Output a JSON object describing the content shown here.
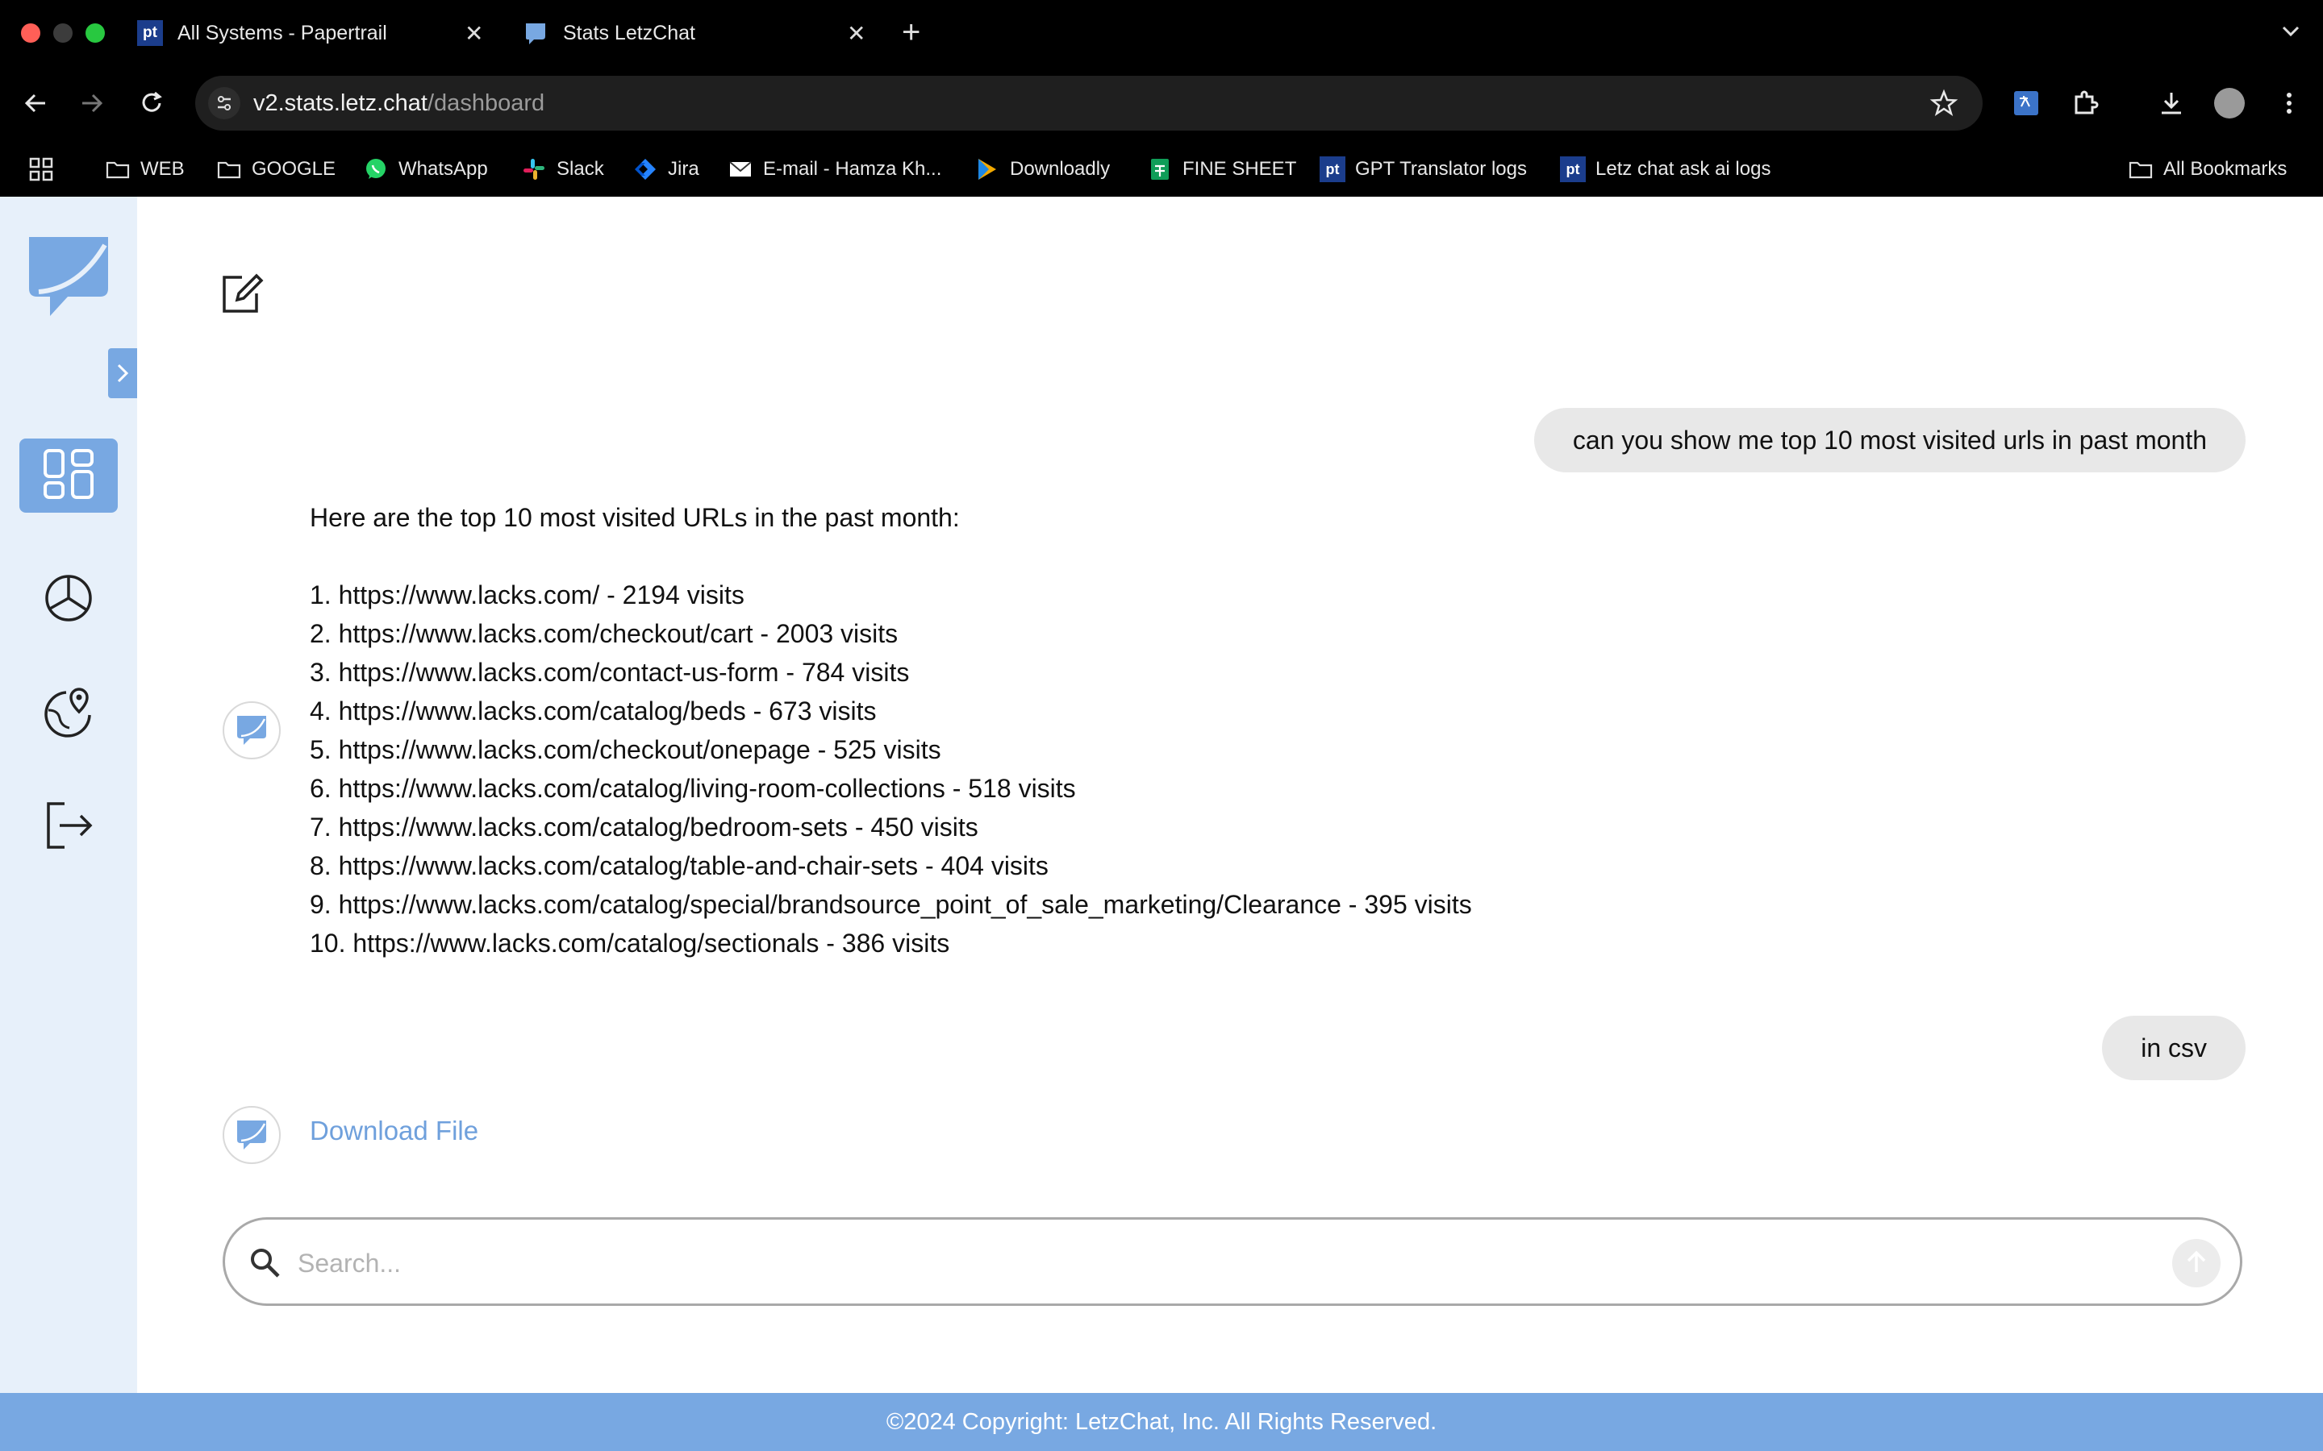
{
  "browser": {
    "tabs": [
      {
        "favicon_text": "pt",
        "title": "All Systems - Papertrail"
      },
      {
        "favicon_text": "",
        "title": "Stats LetzChat"
      }
    ],
    "url_host": "v2.stats.letz.chat",
    "url_path": "/dashboard",
    "bookmarks": [
      {
        "icon": "folder-icon",
        "label": "WEB"
      },
      {
        "icon": "folder-icon",
        "label": "GOOGLE"
      },
      {
        "icon": "whatsapp-icon",
        "label": "WhatsApp"
      },
      {
        "icon": "slack-icon",
        "label": "Slack"
      },
      {
        "icon": "jira-icon",
        "label": "Jira"
      },
      {
        "icon": "mail-icon",
        "label": "E-mail - Hamza Kh..."
      },
      {
        "icon": "downloadly-icon",
        "label": "Downloadly"
      },
      {
        "icon": "sheet-icon",
        "label": "FINE SHEET"
      },
      {
        "icon": "papertrail-icon",
        "icon_text": "pt",
        "label": "GPT Translator logs"
      },
      {
        "icon": "papertrail-icon",
        "icon_text": "pt",
        "label": "Letz chat ask ai logs"
      }
    ],
    "all_bookmarks_label": "All Bookmarks"
  },
  "chat": {
    "messages": [
      {
        "role": "user",
        "text": "can you show me top 10 most visited urls in past month"
      },
      {
        "role": "assistant",
        "intro": "Here are the top 10 most visited URLs in the past month:",
        "items": [
          "1. https://www.lacks.com/ - 2194 visits",
          "2. https://www.lacks.com/checkout/cart - 2003 visits",
          "3. https://www.lacks.com/contact-us-form - 784 visits",
          "4. https://www.lacks.com/catalog/beds - 673 visits",
          "5. https://www.lacks.com/checkout/onepage - 525 visits",
          "6. https://www.lacks.com/catalog/living-room-collections - 518 visits",
          "7. https://www.lacks.com/catalog/bedroom-sets - 450 visits",
          "8. https://www.lacks.com/catalog/table-and-chair-sets - 404 visits",
          "9. https://www.lacks.com/catalog/special/brandsource_point_of_sale_marketing/Clearance - 395 visits",
          "10. https://www.lacks.com/catalog/sectionals - 386 visits"
        ]
      },
      {
        "role": "user",
        "text": "in csv"
      },
      {
        "role": "assistant",
        "link": "Download File"
      }
    ]
  },
  "search": {
    "placeholder": "Search...",
    "value": ""
  },
  "footer": {
    "text": "©2024 Copyright: LetzChat, Inc. All Rights Reserved."
  },
  "colors": {
    "accent": "#78a8e2",
    "sidebar_bg": "#e7f0fa",
    "link": "#6fa0dc",
    "bubble": "#e8e8e8"
  }
}
